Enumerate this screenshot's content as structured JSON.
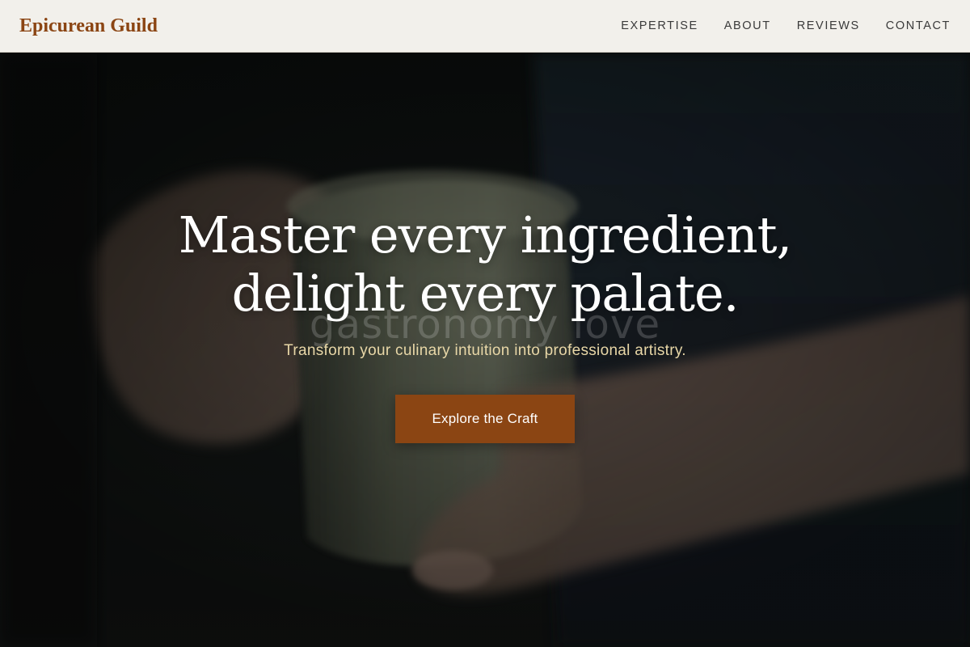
{
  "header": {
    "logo": "Epicurean Guild",
    "nav": [
      {
        "label": "EXPERTISE"
      },
      {
        "label": "ABOUT"
      },
      {
        "label": "REVIEWS"
      },
      {
        "label": "CONTACT"
      }
    ]
  },
  "hero": {
    "title_line1": "Master every ingredient,",
    "title_line2": "delight every palate.",
    "watermark": "gastronomy love",
    "subtitle": "Transform your culinary intuition into professional artistry.",
    "cta_label": "Explore the Craft",
    "background_image": "hands-holding-ceramic-mug"
  },
  "colors": {
    "brand": "#8b4513",
    "header_bg": "#f2f0eb",
    "subtitle": "#e8d7a7",
    "title": "#ffffff"
  }
}
